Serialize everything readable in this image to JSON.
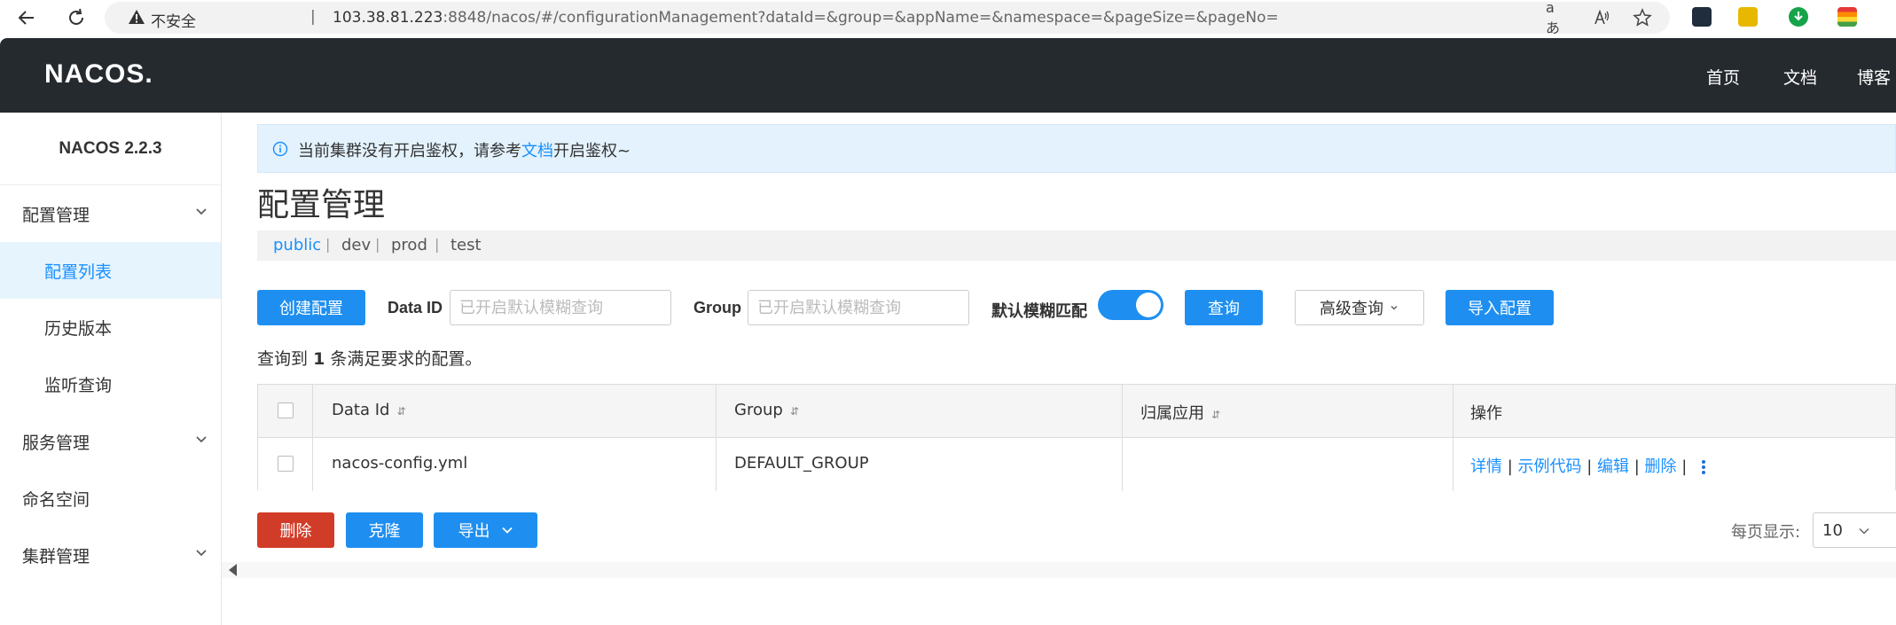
{
  "browser": {
    "insecure_label": "不安全",
    "separator": "|",
    "url_host": "103.38.81.223",
    "url_rest": ":8848/nacos/#/configurationManagement?dataId=&group=&appName=&namespace=&pageSize=&pageNo=",
    "read_aloud": "aあ"
  },
  "header": {
    "logo": "NACOS.",
    "nav": [
      "首页",
      "文档",
      "博客"
    ]
  },
  "sidebar": {
    "version": "NACOS 2.2.3",
    "items": [
      {
        "label": "配置管理"
      },
      {
        "label": "配置列表"
      },
      {
        "label": "历史版本"
      },
      {
        "label": "监听查询"
      },
      {
        "label": "服务管理"
      },
      {
        "label": "命名空间"
      },
      {
        "label": "集群管理"
      }
    ]
  },
  "notice": {
    "prefix": "当前集群没有开启鉴权，请参考",
    "link": "文档",
    "suffix": "开启鉴权~"
  },
  "page": {
    "title": "配置管理"
  },
  "namespaces": [
    "public",
    "dev",
    "prod",
    "test"
  ],
  "toolbar": {
    "create": "创建配置",
    "dataid_label": "Data ID",
    "dataid_placeholder": "已开启默认模糊查询",
    "group_label": "Group",
    "group_placeholder": "已开启默认模糊查询",
    "fuzzy_label": "默认模糊匹配",
    "fuzzy_on": true,
    "query": "查询",
    "advanced": "高级查询",
    "import": "导入配置"
  },
  "result": {
    "prefix": "查询到",
    "count": "1",
    "suffix": "条满足要求的配置。"
  },
  "table": {
    "headers": [
      "Data Id",
      "Group",
      "归属应用",
      "操作"
    ],
    "sort_glyph": "⇵",
    "rows": [
      {
        "data_id": "nacos-config.yml",
        "group": "DEFAULT_GROUP",
        "app": "",
        "ops": [
          "详情",
          "示例代码",
          "编辑",
          "删除"
        ]
      }
    ]
  },
  "bottom": {
    "delete": "删除",
    "clone": "克隆",
    "export": "导出",
    "page_size_label": "每页显示:",
    "page_size": "10"
  },
  "colors": {
    "primary": "#1e8ff0",
    "danger": "#d13c28",
    "header_bg": "#252a2f",
    "active_menu_bg": "#e6f4fd"
  }
}
